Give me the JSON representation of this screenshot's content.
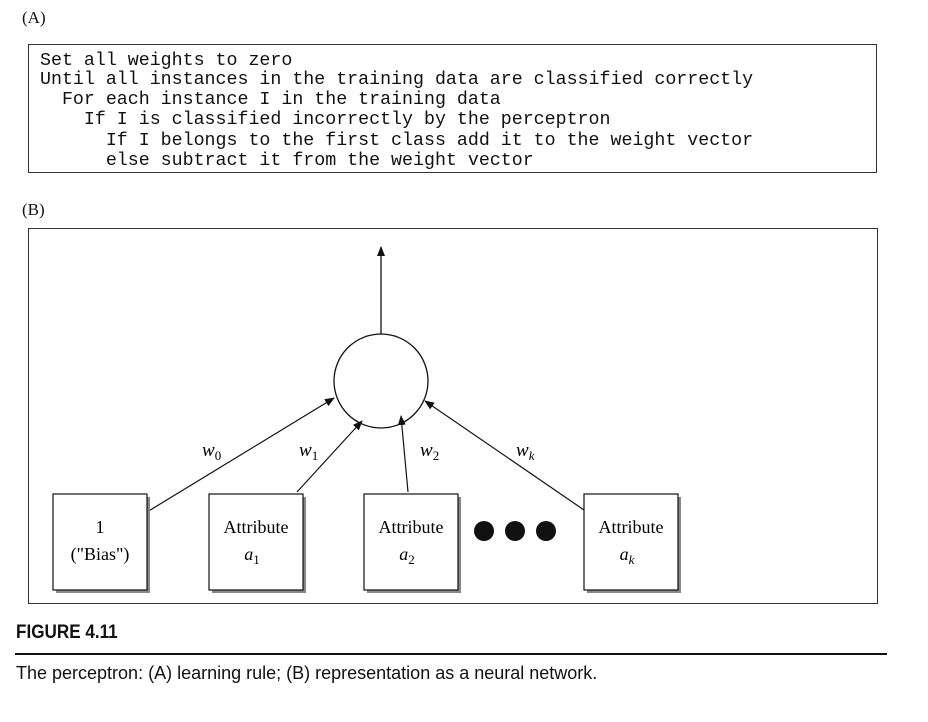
{
  "panel_a": {
    "label": "(A)",
    "lines": [
      "Set all weights to zero",
      "Until all instances in the training data are classified correctly",
      "  For each instance I in the training data",
      "    If I is classified incorrectly by the perceptron",
      "      If I belongs to the first class add it to the weight vector",
      "      else subtract it from the weight vector"
    ]
  },
  "panel_b": {
    "label": "(B)",
    "inputs": [
      {
        "line1": "1",
        "line2": "(\"Bias\")",
        "sub": ""
      },
      {
        "line1": "Attribute",
        "line2": "a",
        "sub": "1"
      },
      {
        "line1": "Attribute",
        "line2": "a",
        "sub": "2"
      },
      {
        "line1": "Attribute",
        "line2": "a",
        "sub": "k"
      }
    ],
    "weights": [
      {
        "w": "w",
        "sub": "0"
      },
      {
        "w": "w",
        "sub": "1"
      },
      {
        "w": "w",
        "sub": "2"
      },
      {
        "w": "w",
        "sub": "k"
      }
    ]
  },
  "figure": {
    "title": "FIGURE 4.11",
    "caption": "The perceptron: (A) learning rule; (B) representation as a neural network."
  }
}
